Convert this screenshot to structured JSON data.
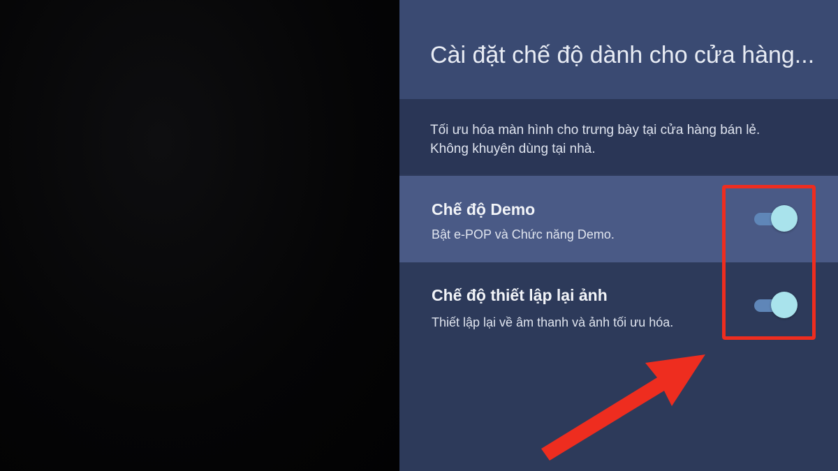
{
  "panel": {
    "title": "Cài đặt chế độ dành cho cửa hàng...",
    "description": [
      "Tối ưu hóa màn hình cho trưng bày tại cửa hàng bán lẻ.",
      "Không khuyên dùng tại nhà."
    ]
  },
  "settings": [
    {
      "title": "Chế độ Demo",
      "subtitle": "Bật e-POP và Chức năng Demo.",
      "enabled": true
    },
    {
      "title": "Chế độ thiết lập lại ảnh",
      "subtitle": "Thiết lập lại về âm thanh và ảnh tối ưu hóa.",
      "enabled": true
    }
  ],
  "colors": {
    "panel_bg": "#2d3a5a",
    "header_bg": "#3a4a72",
    "selected_row_bg": "#4a5a86",
    "toggle_track": "#5f86b8",
    "toggle_knob": "#a9e3ec",
    "annotation": "#ee2d1f"
  },
  "icons": {
    "annotation_arrow": "arrow-icon"
  }
}
